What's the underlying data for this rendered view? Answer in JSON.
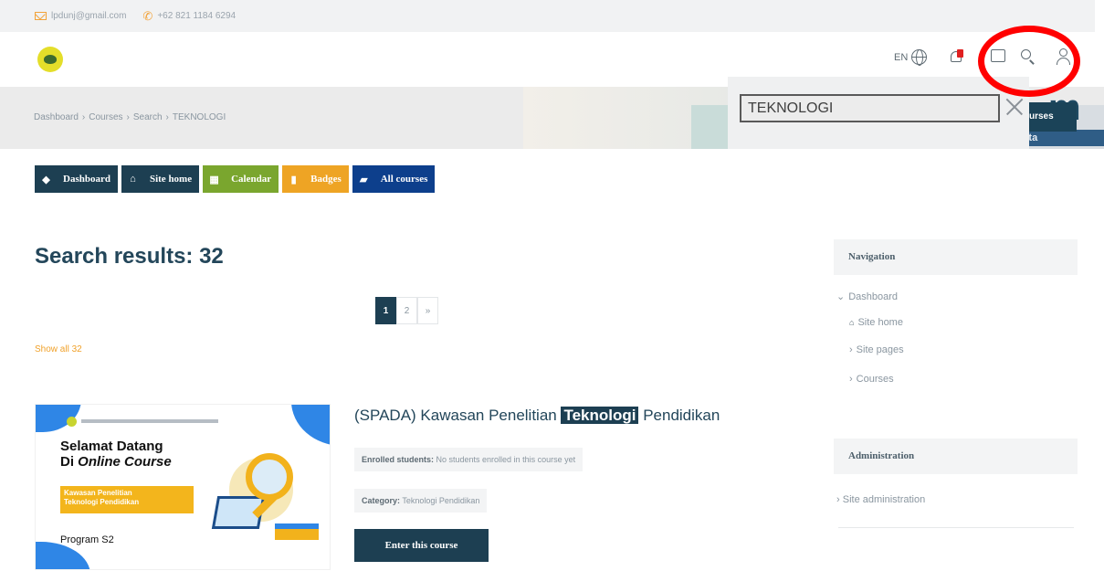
{
  "topbar": {
    "email": "lpdunj@gmail.com",
    "phone": "+62 821 1184 6294"
  },
  "header": {
    "lang": "EN",
    "icons": [
      "globe-icon",
      "notification-bell-icon",
      "chat-icon",
      "search-icon",
      "user-icon"
    ]
  },
  "hero": {
    "courses_button": "urses",
    "banner_text": "Universitas Negeri Jakarta",
    "ghost_letter": "m"
  },
  "breadcrumb": [
    "Dashboard",
    "Courses",
    "Search",
    "TEKNOLOGI"
  ],
  "search": {
    "value": "TEKNOLOGI"
  },
  "nav_buttons": [
    {
      "label": "Dashboard",
      "icon": "dashboard-icon",
      "color": "#1d3f52"
    },
    {
      "label": "Site home",
      "icon": "home-icon",
      "color": "#1d3f52"
    },
    {
      "label": "Calendar",
      "icon": "calendar-icon",
      "color": "#7aa62e"
    },
    {
      "label": "Badges",
      "icon": "bookmark-icon",
      "color": "#eea424"
    },
    {
      "label": "All courses",
      "icon": "courses-icon",
      "color": "#0d3f8c"
    }
  ],
  "main": {
    "title": "Search results: 32",
    "pagination": {
      "pages": [
        "1",
        "2",
        "»"
      ],
      "current": "1"
    },
    "show_all": "Show all 32"
  },
  "course": {
    "title_before": "(SPADA) Kawasan Penelitian ",
    "title_highlight": "Teknologi",
    "title_after": " Pendidikan",
    "enrolled_label": "Enrolled students:",
    "enrolled_value": " No students enrolled in this course yet",
    "category_label": "Category:",
    "category_value": " Teknologi Pendidikan",
    "enter_button": "Enter this course",
    "thumbnail": {
      "line1": "Selamat Datang",
      "line2_prefix": "Di ",
      "line2_italic": "Online Course",
      "tag_line1": "Kawasan Penelitian",
      "tag_line2": "Teknologi Pendidikan",
      "program": "Program S2"
    }
  },
  "sidebar": {
    "navigation": {
      "heading": "Navigation",
      "items": [
        "Dashboard",
        "Site home",
        "Site pages",
        "Courses"
      ]
    },
    "administration": {
      "heading": "Administration",
      "items": [
        "Site administration"
      ]
    }
  },
  "colors": {
    "primary": "#1d3f52",
    "accent": "#f0a12a",
    "annotation_ring": "#ff0000"
  }
}
